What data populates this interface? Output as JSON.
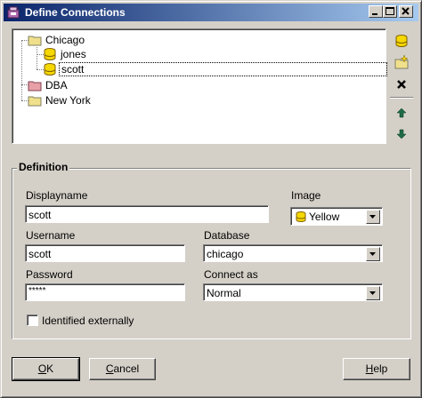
{
  "window": {
    "title": "Define Connections"
  },
  "tree": {
    "nodes": [
      {
        "label": "Chicago",
        "icon": "folder-icon"
      },
      {
        "label": "jones",
        "icon": "database-icon"
      },
      {
        "label": "scott",
        "icon": "database-icon",
        "selected": true
      },
      {
        "label": "DBA",
        "icon": "folder-red-icon"
      },
      {
        "label": "New York",
        "icon": "folder-icon"
      }
    ]
  },
  "side_toolbar": {
    "buttons": [
      "new-connection-icon",
      "new-folder-icon",
      "delete-icon",
      "move-up-icon",
      "move-down-icon"
    ]
  },
  "definition": {
    "group_title": "Definition",
    "displayname_label": "Displayname",
    "displayname_value": "scott",
    "image_label": "Image",
    "image_value": "Yellow",
    "username_label": "Username",
    "username_value": "scott",
    "database_label": "Database",
    "database_value": "chicago",
    "password_label": "Password",
    "password_value": "*****",
    "connect_as_label": "Connect as",
    "connect_as_value": "Normal",
    "identified_externally_label": "Identified externally",
    "identified_externally_checked": false
  },
  "buttons": {
    "ok_hotkey": "O",
    "ok_rest": "K",
    "cancel_hotkey": "C",
    "cancel_rest": "ancel",
    "help_hotkey": "H",
    "help_rest": "elp"
  },
  "colors": {
    "titlebar_start": "#0a246a",
    "titlebar_end": "#a6caf0",
    "face": "#d4d0c8",
    "db_yellow": "#f5d800",
    "folder_yellow": "#f0e08c",
    "folder_red": "#e8a0a8"
  }
}
